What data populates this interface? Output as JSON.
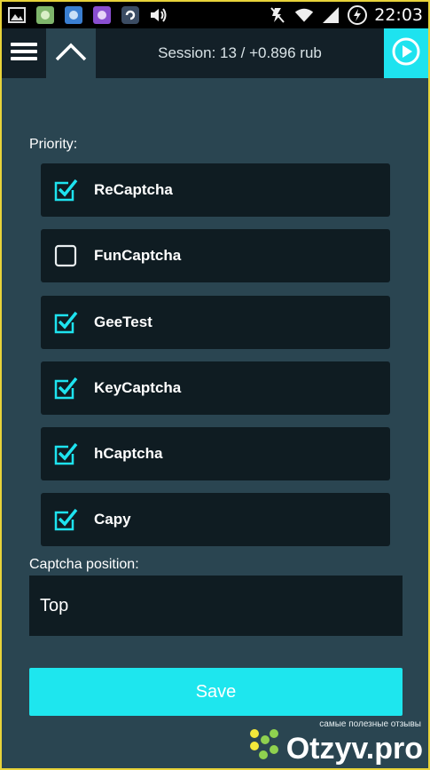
{
  "status_bar": {
    "time": "22:03",
    "left_icons": [
      "gallery-icon",
      "app-icon",
      "app-icon-2",
      "app-icon-3",
      "sync-icon",
      "volume-icon"
    ],
    "right_icons": [
      "mute-icon",
      "wifi-icon",
      "signal-icon",
      "battery-icon"
    ]
  },
  "header": {
    "session_text": "Session: 13 / +0.896 rub",
    "accent_color": "#1ee3ef"
  },
  "priority": {
    "label": "Priority:",
    "items": [
      {
        "label": "ReCaptcha",
        "checked": true
      },
      {
        "label": "FunCaptcha",
        "checked": false
      },
      {
        "label": "GeeTest",
        "checked": true
      },
      {
        "label": "KeyCaptcha",
        "checked": true
      },
      {
        "label": "hCaptcha",
        "checked": true
      },
      {
        "label": "Capy",
        "checked": true
      }
    ]
  },
  "position": {
    "label": "Captcha position:",
    "value": "Top"
  },
  "save": {
    "label": "Save"
  },
  "watermark": {
    "tagline": "самые полезные отзывы",
    "logo": "Otzyv.pro"
  }
}
